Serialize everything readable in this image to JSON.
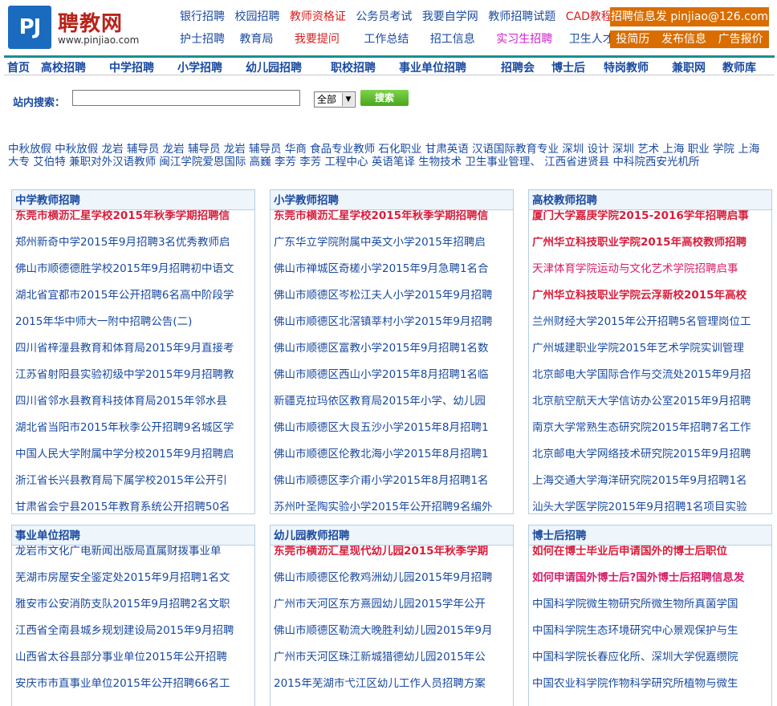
{
  "logo": {
    "badge": "PJ",
    "name": "聘教网",
    "url": "www.pinjiao.com"
  },
  "toplinks": {
    "row1": [
      "银行招聘",
      "校园招聘",
      "教师资格证",
      "公务员考试",
      "我要自学网",
      "教师招聘试题",
      "CAD教程"
    ],
    "row2": [
      "护士招聘",
      "教育局",
      "我要提问",
      "工作总结",
      "招工信息",
      "实习生招聘",
      "卫生人才网"
    ]
  },
  "contact": "招聘信息发 pinjiao@126.com",
  "actions": [
    "投简历",
    "发布信息",
    "广告报价"
  ],
  "nav": [
    "首页",
    "高校招聘",
    "中学招聘",
    "小学招聘",
    "幼儿园招聘",
    "职校招聘",
    "事业单位招聘",
    "招聘会",
    "博士后",
    "特岗教师",
    "兼职网",
    "教师库"
  ],
  "search": {
    "label": "站内搜索：",
    "value": "",
    "select": "全部",
    "button": "搜索"
  },
  "keywords": "中秋放假 中秋放假 龙岩 辅导员 龙岩 辅导员 龙岩 辅导员 华商 食品专业教师 石化职业 甘肃英语 汉语国际教育专业 深圳 设计 深圳 艺术 上海 职业 学院 上海 大专 艾伯特 兼职对外汉语教师 闽江学院爱恩国际 高巍 李芳 李芳 工程中心 英语笔译 生物技术 卫生事业管理、 江西省进贤县 中科院西安光机所",
  "panels": [
    {
      "title": "中学教师招聘",
      "items": [
        "东莞市横沥汇星学校2015年秋季学期招聘信",
        "郑州新奇中学2015年9月招聘3名优秀教师启",
        "佛山市顺德德胜学校2015年9月招聘初中语文",
        "湖北省宜都市2015年公开招聘6名高中阶段学",
        "2015年华中师大一附中招聘公告(二)",
        "四川省梓潼县教育和体育局2015年9月直接考",
        "江苏省射阳县实验初级中学2015年9月招聘教",
        "四川省邻水县教育科技体育局2015年邻水县",
        "湖北省当阳市2015年秋季公开招聘9名城区学",
        "中国人民大学附属中学分校2015年9月招聘启",
        "浙江省长兴县教育局下属学校2015年公开引",
        "甘肃省会宁县2015年教育系统公开招聘50名"
      ]
    },
    {
      "title": "小学教师招聘",
      "items": [
        "东莞市横沥汇星学校2015年秋季学期招聘信",
        "广东华立学院附属中英文小学2015年招聘启",
        "佛山市禅城区奇槎小学2015年9月急聘1名合",
        "佛山市顺德区岑松江夫人小学2015年9月招聘",
        "佛山市顺德区北滘镇莘村小学2015年9月招聘",
        "佛山市顺德区富教小学2015年9月招聘1名数",
        "佛山市顺德区西山小学2015年8月招聘1名临",
        "新疆克拉玛依区教育局2015年小学、幼儿园",
        "佛山市顺德区大良五沙小学2015年8月招聘1",
        "佛山市顺德区伦教北海小学2015年8月招聘1",
        "佛山市顺德区李介甫小学2015年8月招聘1名",
        "苏州叶圣陶实验小学2015年公开招聘9名编外"
      ]
    },
    {
      "title": "高校教师招聘",
      "items": [
        "厦门大学嘉庚学院2015-2016学年招聘启事",
        "广州华立科技职业学院2015年高校教师招聘",
        "天津体育学院运动与文化艺术学院招聘启事",
        "广州华立科技职业学院云浮新校2015年高校",
        "兰州财经大学2015年公开招聘5名管理岗位工",
        "广州城建职业学院2015年艺术学院实训管理",
        "北京邮电大学国际合作与交流处2015年9月招",
        "北京航空航天大学信访办公室2015年9月招聘",
        "南京大学常熟生态研究院2015年招聘7名工作",
        "北京邮电大学网络技术研究院2015年9月招聘",
        "上海交通大学海洋研究院2015年9月招聘1名",
        "汕头大学医学院2015年9月招聘1名项目实验"
      ]
    },
    {
      "title": "事业单位招聘",
      "items": [
        "龙岩市文化广电新闻出版局直属财拨事业单",
        "芜湖市房屋安全鉴定处2015年9月招聘1名文",
        "雅安市公安消防支队2015年9月招聘2名文职",
        "江西省全南县城乡规划建设局2015年9月招聘",
        "山西省太谷县部分事业单位2015年公开招聘",
        "安庆市市直事业单位2015年公开招聘66名工"
      ]
    },
    {
      "title": "幼儿园教师招聘",
      "items": [
        "东莞市横沥汇星现代幼儿园2015年秋季学期",
        "佛山市顺德区伦教鸡洲幼儿园2015年9月招聘",
        "广州市天河区东方熹园幼儿园2015学年公开",
        "佛山市顺德区勒流大晚胜利幼儿园2015年9月",
        "广州市天河区珠江新城猎德幼儿园2015年公",
        "2015年芜湖市弋江区幼儿工作人员招聘方案"
      ]
    },
    {
      "title": "博士后招聘",
      "items": [
        "如何在博士毕业后申请国外的博士后职位",
        "如何申请国外博士后?国外博士后招聘信息发",
        "中国科学院微生物研究所微生物所真菌学国",
        "中国科学院生态环境研究中心景观保护与生",
        "中国科学院长春应化所、深圳大学倪嘉缵院",
        "中国农业科学院作物科学研究所植物与微生"
      ]
    }
  ]
}
